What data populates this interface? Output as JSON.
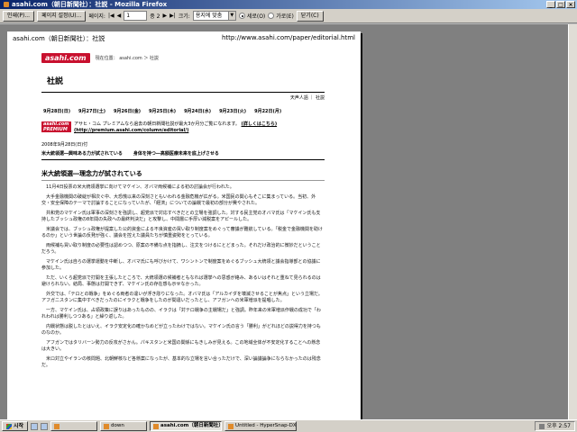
{
  "window": {
    "title": "asahi.com（朝日新聞社）：社説 - Mozilla Firefox",
    "controls": [
      "_",
      "□",
      "×"
    ]
  },
  "toolbar": {
    "print_label": "인쇄(P)...",
    "page_setup_label": "페이지 설정(U)...",
    "page_label": "페이지:",
    "page_value": "1",
    "page_total": "중 2",
    "scale_label": "크기:",
    "scale_value": "용지에 맞춤",
    "portrait_label": "세로(O)",
    "landscape_label": "가로(E)",
    "close_label": "닫기(C)"
  },
  "paper": {
    "header_left": "asahi.com（朝日新聞社）：社説",
    "header_right": "http://www.asahi.com/paper/editorial.html",
    "logo_text": "asahi.com",
    "breadcrumb": "現在位置： asahi.com ＞ 社説",
    "section_title": "社説",
    "tools_text": "天声人語 ｜ 社説",
    "date_tabs": [
      "9月28日(日)",
      "9月27日(土)",
      "9月26日(金)",
      "9月25日(木)",
      "9月24日(水)",
      "9月23日(火)",
      "9月22日(月)"
    ],
    "premium_logo": "asahi.com PREMIUM",
    "premium_text": "アサヒ・コム プレミアムなら過去の朝日新聞社説が最大3か月分ご覧になれます。",
    "premium_link": "(詳しくはこちら) (http://premium.asahi.com/column/editorial/)",
    "article_date": "2008年9月28日(日)付",
    "headlines": [
      "米大統領選―興味ある力が試されている",
      "身体を持つ―高額医療未来を底上げさせる"
    ],
    "article_title": "米大統領選―理念力が試されている",
    "paragraphs": [
      "11月4日投票の米大統領選挙に向けてマケイン、オバマ両候補による初の討論会が行われた。",
      "大手金融機関の破綻が相次ぐ中、大恐慌以来の深刻さともいわれる金融危機が広がる。米国民の関心もそこに集まっている。当初、外交・安全保障のテーマで討論することになっていたが、「経済」についての論戦で最初の部分が費やされた。",
      "共和党のマケイン氏は軍事の深刻さを強調し、超党派で対応すべきだとの立場を強調した。対する民主党のオバマ氏は「マケイン氏も支持したブッシュ政権の8年間の失政への最終判決だ」と攻撃し、中間層に手厚い減税案をアピールした。",
      "米議会では、ブッシュ政権が提案した公的資金による不良資産の買い取り制度案をめぐって審議が難航している。「税金で金融機関を助けるのか」という世論の反発が強く、議会を控えた議員たちが慎重姿勢をとっている。",
      "両候補も買い取り制度の必要性は認めつつ、原案の不備な点を指摘し、注文をつけるにとどまった。それだけ政治的に微妙だということだろう。",
      "マケイン氏は自らの選挙運動を中断し、オバマ氏にも呼びかけて、ワシントンで制度案をめぐるブッシュ大統領と議会指導部との協議に参加した。",
      "ただ、いくら超党派で打開を主張したところで、大統領選の候補者ともなれば選挙への思惑が絡み、あるいはそれと重ねて見られるのは避けられない。結局、事態は打開できず、マケイン氏の存在感も示せなかった。",
      "外交では、「テロとの戦争」をめぐる両者の違いが浮き彫りになった。オバマ氏は「アルカイダを壊滅させることが焦点」という立場だ。アフガニスタンに集中すべきだったのにイラクと戦争をしたのが間違いだったとし、アフガンへの米軍増派を提唱した。",
      "一方、マケイン氏は、占領政策に誤りはあったものの、イラクは「対テロ戦争の主戦場だ」と強調。昨年来の米軍増派作戦の成功で「われわれは勝利しつつある」と繰り返した。",
      "内戦状態は脱したとはいえ、イラク安定化の確かなめどが立ったわけではない。マケイン氏の言う「勝利」がどれほどの説得力を持つものなのか。",
      "アフガンではタリバーン勢力の反攻がさかん。パキスタンと米国の関係にもきしみが見える。この地域全体が不安定化することへの懸念は大きい。",
      "米ロ対立やイランの核問題、北朝鮮核など各懸案になったが、基本的な立場を言い合っただけで、深い論議論争にならなかったのは残念だ。"
    ]
  },
  "taskbar": {
    "start_label": "시작",
    "tasks": [
      "",
      "down",
      "asahi.com（朝日新聞社）：",
      "Untitled - HyperSnap-DX"
    ],
    "active_index": 2,
    "clock": "오후 2:57"
  }
}
